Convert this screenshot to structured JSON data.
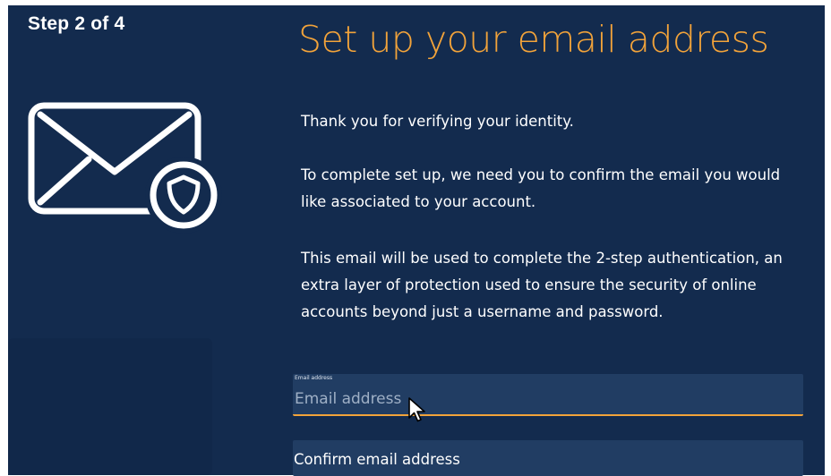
{
  "progress": {
    "step_label": "Step 2 of 4"
  },
  "icons": {
    "main": "mail-shield-icon",
    "pointer": "mouse-cursor-icon"
  },
  "page": {
    "title": "Set up your email address",
    "paragraphs": [
      "Thank you for verifying your identity.",
      "To complete set up, we need you to confirm the email you would like associated to your account.",
      "This email will be used to complete the 2-step authentication, an extra layer of protection used to ensure the security of online accounts beyond just a username and password."
    ]
  },
  "form": {
    "email": {
      "label": "Email address",
      "placeholder": "Email address",
      "value": ""
    },
    "confirm_email": {
      "label": "Confirm email address"
    }
  },
  "colors": {
    "background": "#132b4e",
    "accent": "#f2a33a",
    "field_background": "#213d63",
    "text": "#ffffff"
  }
}
